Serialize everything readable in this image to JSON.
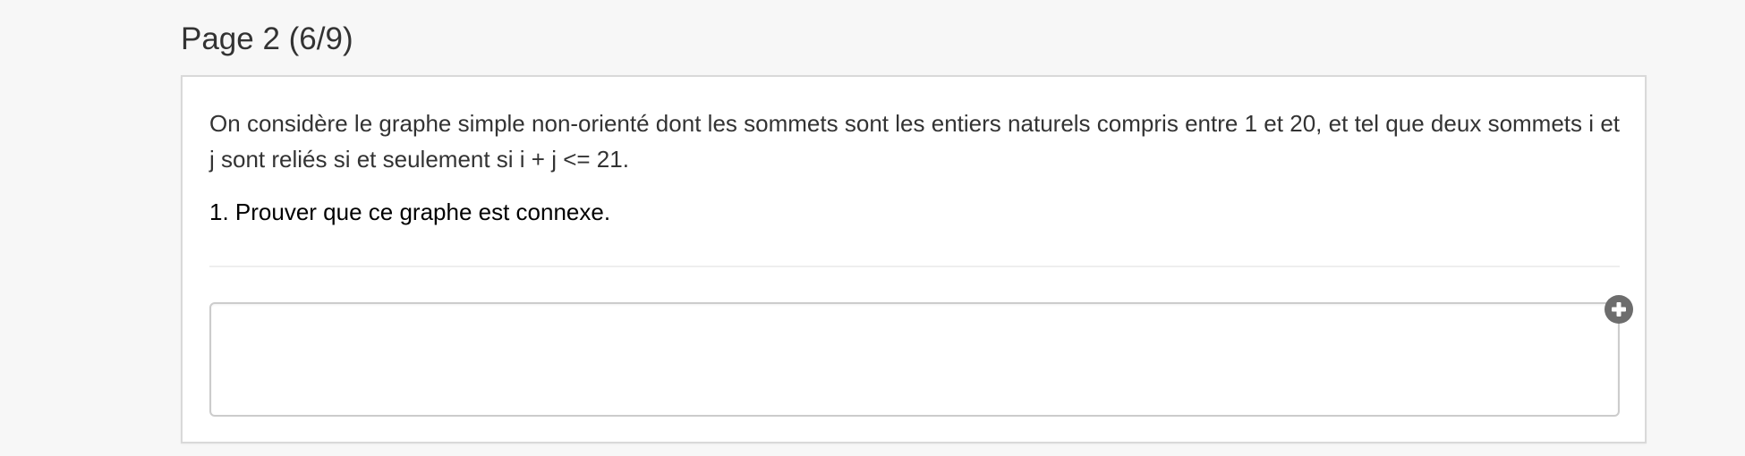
{
  "page": {
    "title": "Page 2 (6/9)"
  },
  "question": {
    "statement": "On considère le graphe simple non-orienté dont les sommets sont les entiers naturels compris entre 1 et 20, et tel que deux sommets i et j sont reliés si et seulement si i + j <= 21.",
    "prompt": "1. Prouver que ce graphe est connexe."
  },
  "answer": {
    "value": "",
    "add_icon": "plus-circle-icon"
  },
  "colors": {
    "background": "#f7f7f7",
    "card": "#ffffff",
    "text": "#333333",
    "icon": "#6d6d6d"
  }
}
